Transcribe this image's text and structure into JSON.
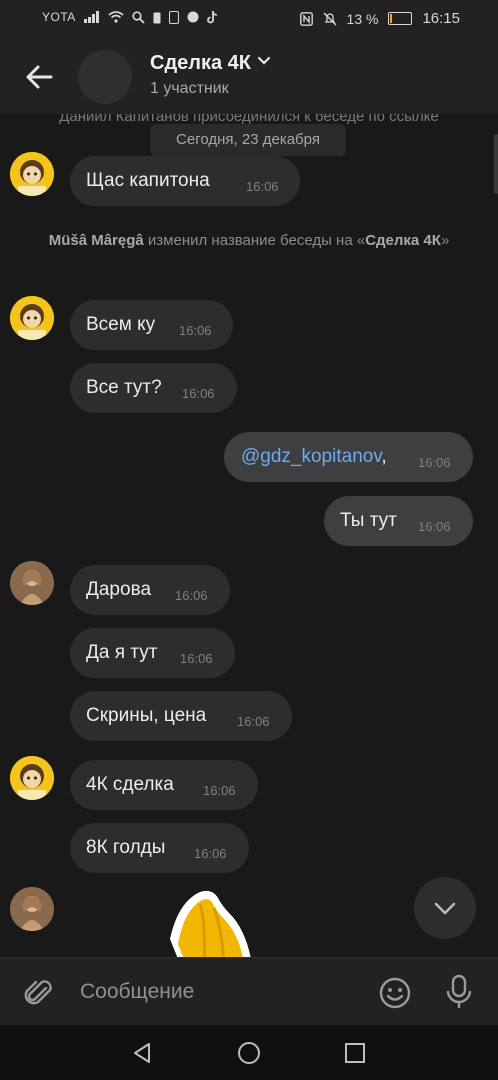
{
  "status_bar": {
    "carrier": "YOTA",
    "battery": "13 %",
    "battery_level_pct": 13,
    "time": "16:15"
  },
  "header": {
    "title": "Сделка 4К",
    "subtitle": "1 участник"
  },
  "chat": {
    "hidden_system_text": "Даниил Капитанов присоединился к беседе по ссылке",
    "date_label": "Сегодня, 23 декабря",
    "rename_event": {
      "actor": "Müšâ Mâręgâ",
      "action": " изменил название беседы на «",
      "new_name": "Сделка 4К",
      "close": "»"
    },
    "messages": [
      {
        "text": "Щас капитона",
        "time": "16:06"
      },
      {
        "text": "Всем ку",
        "time": "16:06"
      },
      {
        "text": "Все тут?",
        "time": "16:06"
      },
      {
        "mention": "@gdz_kopitanov",
        "text": ",",
        "time": "16:06"
      },
      {
        "text": "Ты тут",
        "time": "16:06"
      },
      {
        "text": "Дарова",
        "time": "16:06"
      },
      {
        "text": "Да я тут",
        "time": "16:06"
      },
      {
        "text": "Скрины, цена",
        "time": "16:06"
      },
      {
        "text": "4К сделка",
        "time": "16:06"
      },
      {
        "text": "8К голды",
        "time": "16:06"
      }
    ]
  },
  "composer": {
    "placeholder": "Сообщение"
  },
  "colors": {
    "background": "#19191a",
    "bubble_in": "#2c2d2e",
    "bubble_out": "#3e3f41",
    "mention": "#71aaeb",
    "battery_low": "#f5a623"
  }
}
